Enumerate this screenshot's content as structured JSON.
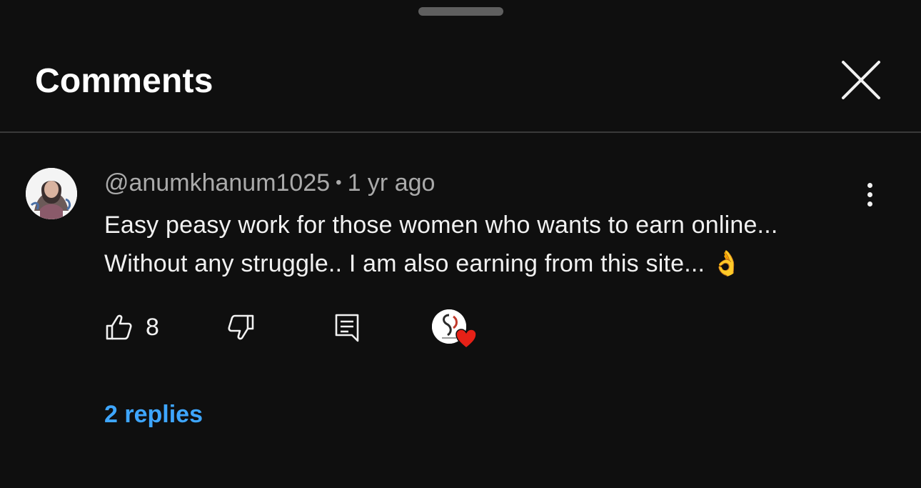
{
  "sheet": {
    "title": "Comments",
    "close_icon": "close-icon"
  },
  "comment": {
    "author": "@anumkhanum1025",
    "separator": "•",
    "time": "1 yr ago",
    "text": "Easy peasy work for those women who wants to earn online...\nWithout any struggle..  I am also earning from this site... 👌",
    "likes": "8",
    "replies_label": "2 replies",
    "more_icon": "more-vert-icon",
    "like_icon": "thumb-up-icon",
    "dislike_icon": "thumb-down-icon",
    "reply_icon": "comment-reply-icon",
    "creator_heart_icon": "creator-heart-icon"
  },
  "colors": {
    "background": "#0f0f0f",
    "text": "#f1f1f1",
    "secondary_text": "#aaaaaa",
    "link": "#3ea6ff",
    "heart": "#e62117"
  }
}
